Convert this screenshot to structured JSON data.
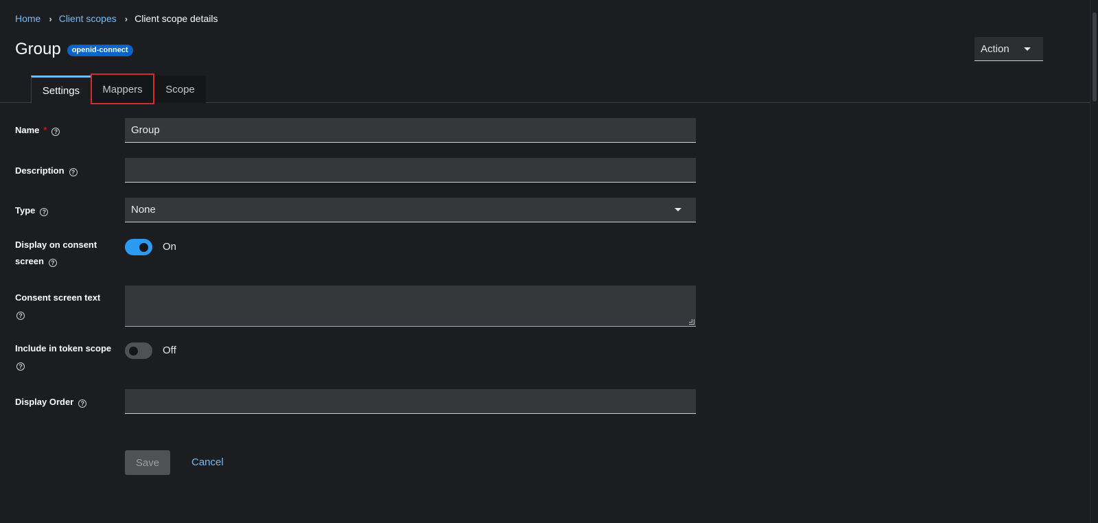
{
  "breadcrumb": {
    "home": "Home",
    "client_scopes": "Client scopes",
    "current": "Client scope details"
  },
  "header": {
    "title": "Group",
    "badge": "openid-connect",
    "action_label": "Action"
  },
  "tabs": [
    {
      "label": "Settings",
      "active": true
    },
    {
      "label": "Mappers",
      "active": false,
      "highlighted": true
    },
    {
      "label": "Scope",
      "active": false
    }
  ],
  "form": {
    "name_label": "Name",
    "name_required_mark": "*",
    "name_value": "Group",
    "description_label": "Description",
    "description_value": "",
    "type_label": "Type",
    "type_value": "None",
    "consent_display_label_line1": "Display on consent",
    "consent_display_label_line2": "screen",
    "consent_display_state": "On",
    "consent_text_label": "Consent screen text",
    "consent_text_value": "",
    "include_token_label": "Include in token scope",
    "include_token_state": "Off",
    "display_order_label": "Display Order",
    "display_order_value": "",
    "help_glyph": "?"
  },
  "buttons": {
    "save": "Save",
    "cancel": "Cancel"
  },
  "colors": {
    "background": "#1b1d21",
    "link": "#73bcf7",
    "badge": "#0066cc",
    "switch_on": "#2b9af3",
    "highlight": "#d62b2b",
    "required": "#c9190b"
  },
  "icons": {
    "breadcrumb_separator": "chevron-right-icon",
    "dropdown": "caret-down-icon",
    "help": "question-circle-icon",
    "resize": "resize-handle-icon"
  }
}
